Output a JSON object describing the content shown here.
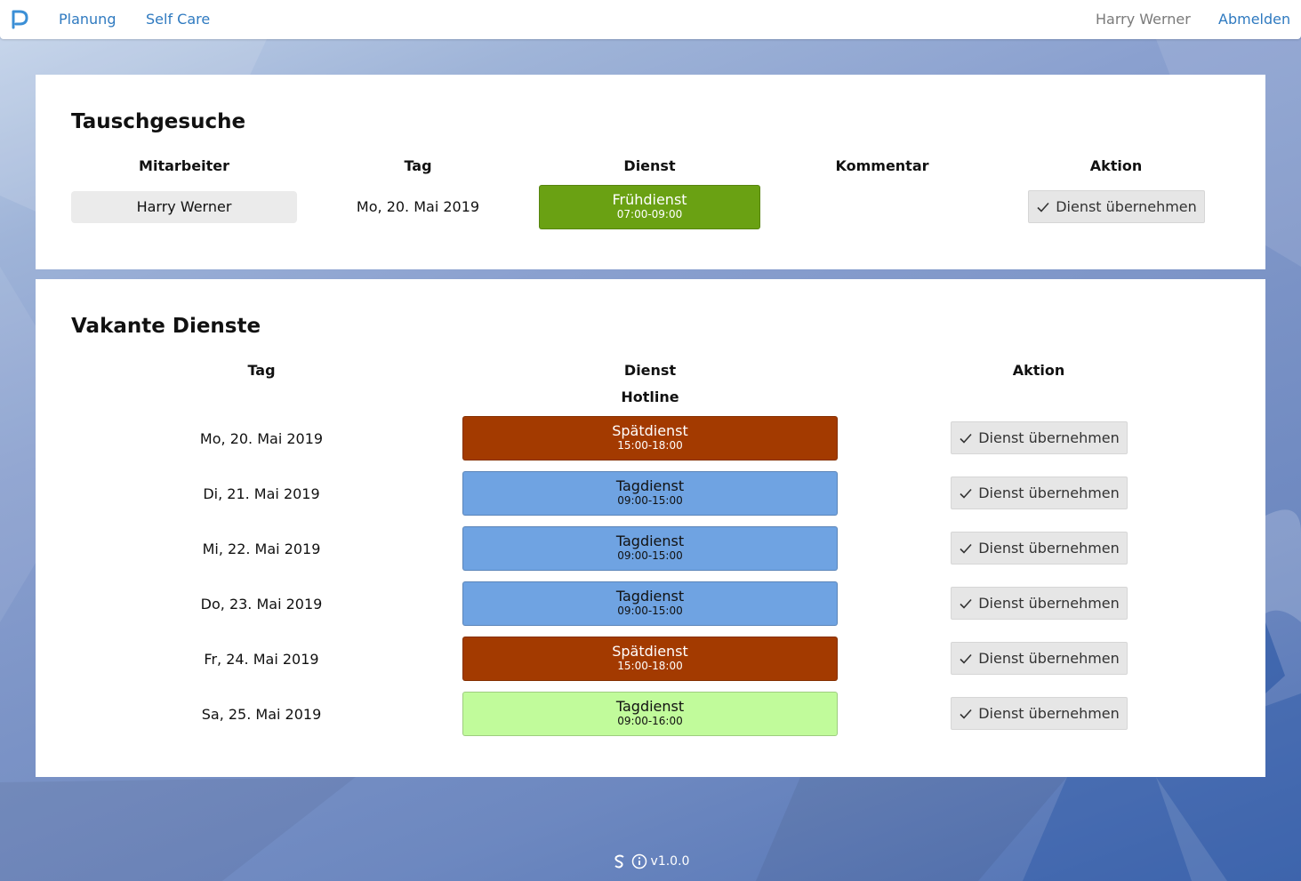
{
  "navbar": {
    "links": [
      "Planung",
      "Self Care"
    ],
    "user_name": "Harry Werner",
    "logout": "Abmelden"
  },
  "swap": {
    "title": "Tauschgesuche",
    "headers": [
      "Mitarbeiter",
      "Tag",
      "Dienst",
      "Kommentar",
      "Aktion"
    ],
    "row": {
      "employee": "Harry Werner",
      "day": "Mo, 20. Mai 2019",
      "shift_name": "Frühdienst",
      "shift_time": "07:00-09:00",
      "shift_color": "#6aa113",
      "comment": "",
      "action": "Dienst übernehmen"
    }
  },
  "vacant": {
    "title": "Vakante Dienste",
    "headers": [
      "Tag",
      "Dienst",
      "Aktion"
    ],
    "group": "Hotline",
    "action_label": "Dienst übernehmen",
    "rows": [
      {
        "day": "Mo, 20. Mai 2019",
        "shift_name": "Spätdienst",
        "shift_time": "15:00-18:00",
        "color": "#a33a00",
        "text_color": "#ffffff"
      },
      {
        "day": "Di, 21. Mai 2019",
        "shift_name": "Tagdienst",
        "shift_time": "09:00-15:00",
        "color": "#6fa3e2",
        "text_color": "#111111"
      },
      {
        "day": "Mi, 22. Mai 2019",
        "shift_name": "Tagdienst",
        "shift_time": "09:00-15:00",
        "color": "#6fa3e2",
        "text_color": "#111111"
      },
      {
        "day": "Do, 23. Mai 2019",
        "shift_name": "Tagdienst",
        "shift_time": "09:00-15:00",
        "color": "#6fa3e2",
        "text_color": "#111111"
      },
      {
        "day": "Fr, 24. Mai 2019",
        "shift_name": "Spätdienst",
        "shift_time": "15:00-18:00",
        "color": "#a33a00",
        "text_color": "#ffffff"
      },
      {
        "day": "Sa, 25. Mai 2019",
        "shift_name": "Tagdienst",
        "shift_time": "09:00-16:00",
        "color": "#c1fb9b",
        "text_color": "#111111"
      }
    ]
  },
  "footer": {
    "version": "v1.0.0"
  }
}
